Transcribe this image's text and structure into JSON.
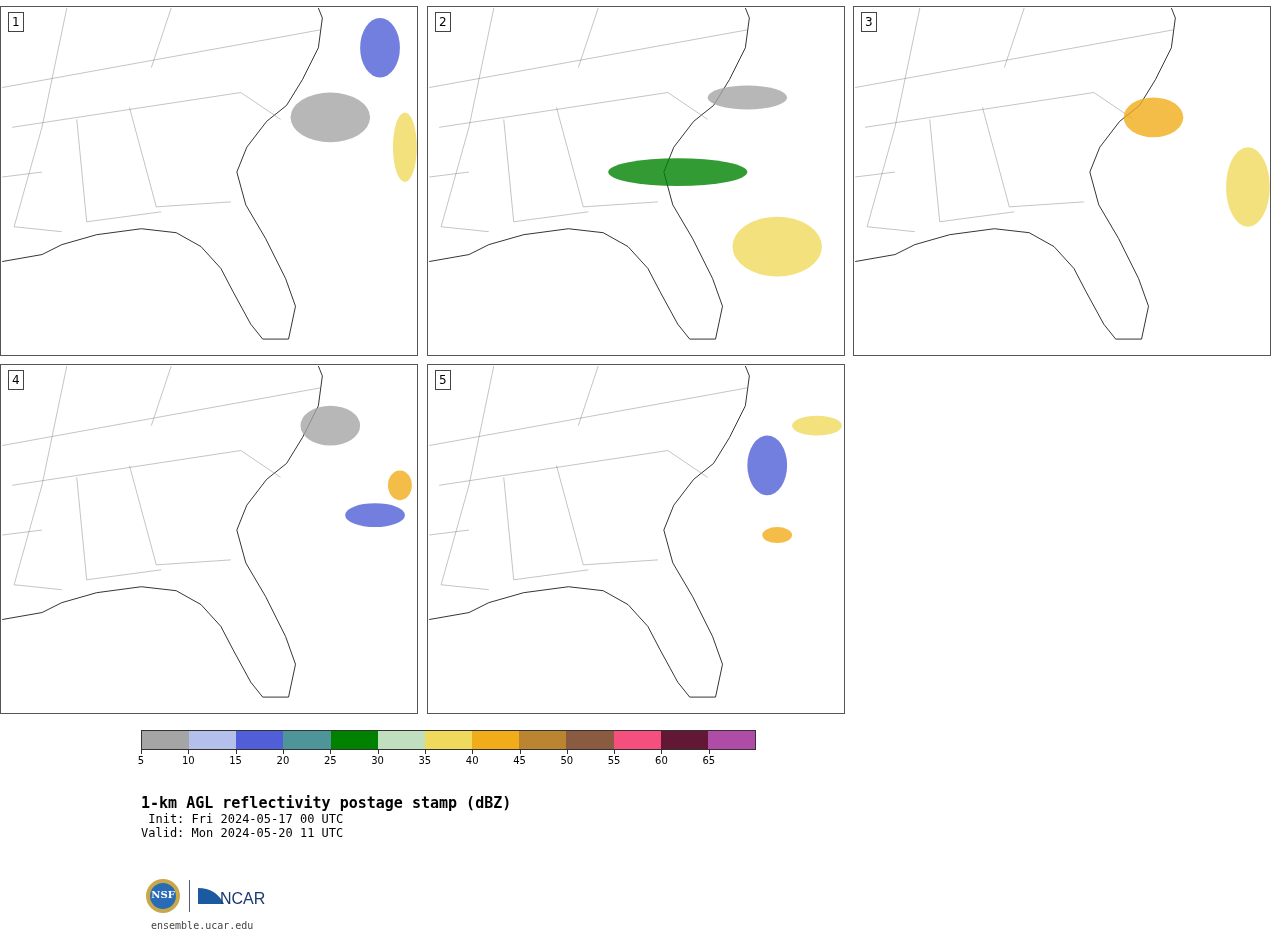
{
  "panels": [
    {
      "label": "1"
    },
    {
      "label": "2"
    },
    {
      "label": "3"
    },
    {
      "label": "4"
    },
    {
      "label": "5"
    }
  ],
  "colorbar": {
    "bins": [
      {
        "color": "#a5a5a5"
      },
      {
        "color": "#b4bfeb"
      },
      {
        "color": "#505fd7"
      },
      {
        "color": "#4d9599"
      },
      {
        "color": "#008200"
      },
      {
        "color": "#bfdfbf"
      },
      {
        "color": "#f0da5e"
      },
      {
        "color": "#f0ad19"
      },
      {
        "color": "#ba8431"
      },
      {
        "color": "#8a5b41"
      },
      {
        "color": "#f5507d"
      },
      {
        "color": "#621735"
      },
      {
        "color": "#ae4ca8"
      }
    ],
    "ticks": [
      "5",
      "10",
      "15",
      "20",
      "25",
      "30",
      "35",
      "40",
      "45",
      "50",
      "55",
      "60",
      "65"
    ]
  },
  "title": "1-km AGL reflectivity postage stamp (dBZ)",
  "info_lines": [
    " Init: Fri 2024-05-17 00 UTC",
    "Valid: Mon 2024-05-20 11 UTC"
  ],
  "logos": {
    "nsf": "NSF",
    "ncar": "NCAR"
  },
  "url": "ensemble.ucar.edu"
}
